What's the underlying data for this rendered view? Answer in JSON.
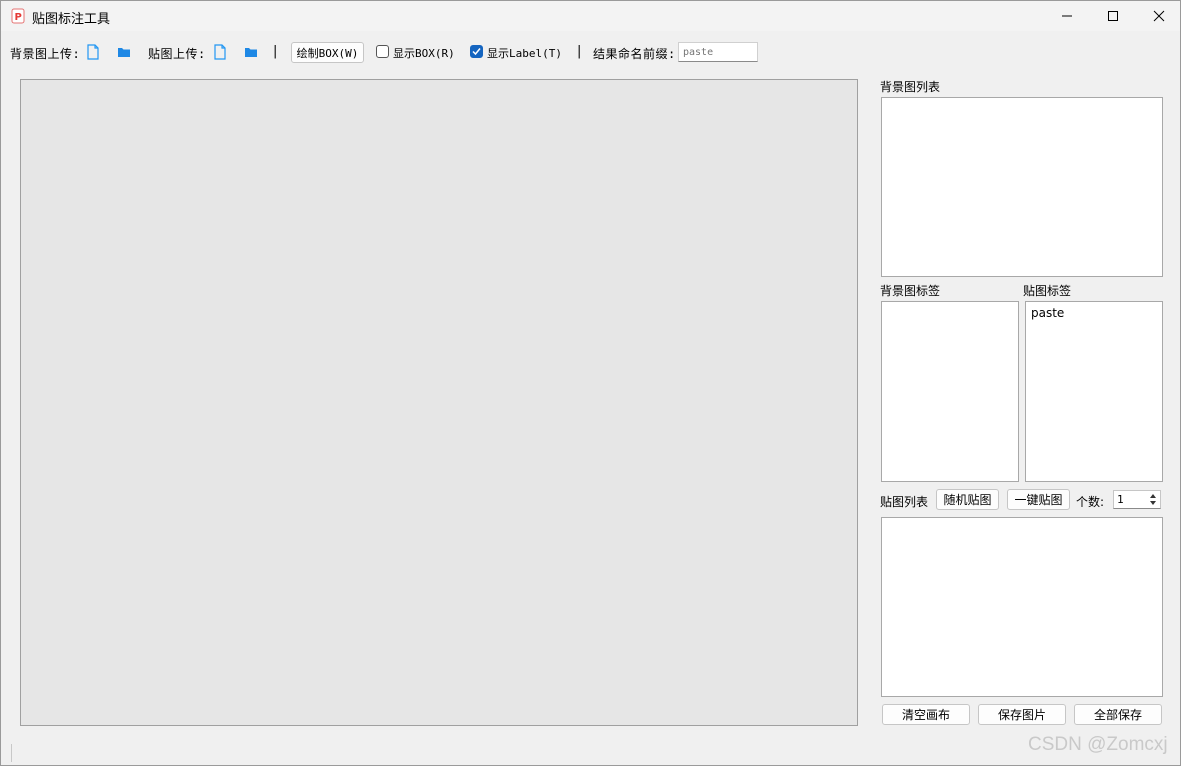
{
  "window": {
    "title": "贴图标注工具"
  },
  "toolbar": {
    "bg_upload_label": "背景图上传:",
    "paste_upload_label": "贴图上传:",
    "separator": "|",
    "draw_box_label": "绘制BOX(W)",
    "show_box_label": "显示BOX(R)",
    "show_box_checked": false,
    "show_label_label": "显示Label(T)",
    "show_label_checked": true,
    "prefix_label": "结果命名前缀:",
    "prefix_placeholder": "paste"
  },
  "right_panel": {
    "bg_list_label": "背景图列表",
    "bg_tags_label": "背景图标签",
    "paste_tags_label": "贴图标签",
    "paste_tags": [
      "paste"
    ],
    "paste_list_label": "贴图列表",
    "random_paste_button": "随机贴图",
    "one_click_paste_button": "一键贴图",
    "count_label": "个数:",
    "count_value": "1",
    "clear_canvas_button": "清空画布",
    "save_image_button": "保存图片",
    "save_all_button": "全部保存"
  },
  "watermark": "CSDN @Zomcxj",
  "colors": {
    "accent": "#1565c0",
    "icon_blue": "#2196f3"
  }
}
